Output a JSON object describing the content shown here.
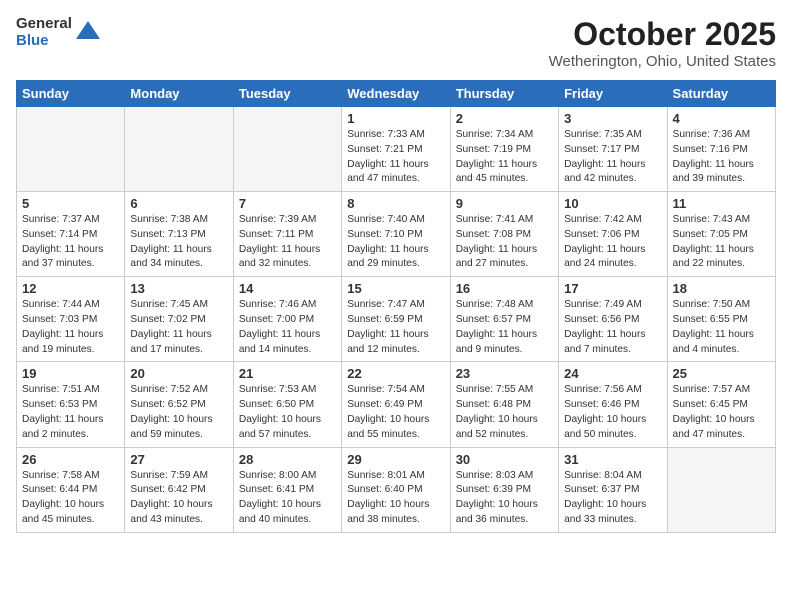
{
  "header": {
    "logo": {
      "line1": "General",
      "line2": "Blue"
    },
    "title": "October 2025",
    "location": "Wetherington, Ohio, United States"
  },
  "days_of_week": [
    "Sunday",
    "Monday",
    "Tuesday",
    "Wednesday",
    "Thursday",
    "Friday",
    "Saturday"
  ],
  "weeks": [
    [
      {
        "num": "",
        "empty": true
      },
      {
        "num": "",
        "empty": true
      },
      {
        "num": "",
        "empty": true
      },
      {
        "num": "1",
        "sunrise": "7:33 AM",
        "sunset": "7:21 PM",
        "daylight": "11 hours and 47 minutes."
      },
      {
        "num": "2",
        "sunrise": "7:34 AM",
        "sunset": "7:19 PM",
        "daylight": "11 hours and 45 minutes."
      },
      {
        "num": "3",
        "sunrise": "7:35 AM",
        "sunset": "7:17 PM",
        "daylight": "11 hours and 42 minutes."
      },
      {
        "num": "4",
        "sunrise": "7:36 AM",
        "sunset": "7:16 PM",
        "daylight": "11 hours and 39 minutes."
      }
    ],
    [
      {
        "num": "5",
        "sunrise": "7:37 AM",
        "sunset": "7:14 PM",
        "daylight": "11 hours and 37 minutes."
      },
      {
        "num": "6",
        "sunrise": "7:38 AM",
        "sunset": "7:13 PM",
        "daylight": "11 hours and 34 minutes."
      },
      {
        "num": "7",
        "sunrise": "7:39 AM",
        "sunset": "7:11 PM",
        "daylight": "11 hours and 32 minutes."
      },
      {
        "num": "8",
        "sunrise": "7:40 AM",
        "sunset": "7:10 PM",
        "daylight": "11 hours and 29 minutes."
      },
      {
        "num": "9",
        "sunrise": "7:41 AM",
        "sunset": "7:08 PM",
        "daylight": "11 hours and 27 minutes."
      },
      {
        "num": "10",
        "sunrise": "7:42 AM",
        "sunset": "7:06 PM",
        "daylight": "11 hours and 24 minutes."
      },
      {
        "num": "11",
        "sunrise": "7:43 AM",
        "sunset": "7:05 PM",
        "daylight": "11 hours and 22 minutes."
      }
    ],
    [
      {
        "num": "12",
        "sunrise": "7:44 AM",
        "sunset": "7:03 PM",
        "daylight": "11 hours and 19 minutes."
      },
      {
        "num": "13",
        "sunrise": "7:45 AM",
        "sunset": "7:02 PM",
        "daylight": "11 hours and 17 minutes."
      },
      {
        "num": "14",
        "sunrise": "7:46 AM",
        "sunset": "7:00 PM",
        "daylight": "11 hours and 14 minutes."
      },
      {
        "num": "15",
        "sunrise": "7:47 AM",
        "sunset": "6:59 PM",
        "daylight": "11 hours and 12 minutes."
      },
      {
        "num": "16",
        "sunrise": "7:48 AM",
        "sunset": "6:57 PM",
        "daylight": "11 hours and 9 minutes."
      },
      {
        "num": "17",
        "sunrise": "7:49 AM",
        "sunset": "6:56 PM",
        "daylight": "11 hours and 7 minutes."
      },
      {
        "num": "18",
        "sunrise": "7:50 AM",
        "sunset": "6:55 PM",
        "daylight": "11 hours and 4 minutes."
      }
    ],
    [
      {
        "num": "19",
        "sunrise": "7:51 AM",
        "sunset": "6:53 PM",
        "daylight": "11 hours and 2 minutes."
      },
      {
        "num": "20",
        "sunrise": "7:52 AM",
        "sunset": "6:52 PM",
        "daylight": "10 hours and 59 minutes."
      },
      {
        "num": "21",
        "sunrise": "7:53 AM",
        "sunset": "6:50 PM",
        "daylight": "10 hours and 57 minutes."
      },
      {
        "num": "22",
        "sunrise": "7:54 AM",
        "sunset": "6:49 PM",
        "daylight": "10 hours and 55 minutes."
      },
      {
        "num": "23",
        "sunrise": "7:55 AM",
        "sunset": "6:48 PM",
        "daylight": "10 hours and 52 minutes."
      },
      {
        "num": "24",
        "sunrise": "7:56 AM",
        "sunset": "6:46 PM",
        "daylight": "10 hours and 50 minutes."
      },
      {
        "num": "25",
        "sunrise": "7:57 AM",
        "sunset": "6:45 PM",
        "daylight": "10 hours and 47 minutes."
      }
    ],
    [
      {
        "num": "26",
        "sunrise": "7:58 AM",
        "sunset": "6:44 PM",
        "daylight": "10 hours and 45 minutes."
      },
      {
        "num": "27",
        "sunrise": "7:59 AM",
        "sunset": "6:42 PM",
        "daylight": "10 hours and 43 minutes."
      },
      {
        "num": "28",
        "sunrise": "8:00 AM",
        "sunset": "6:41 PM",
        "daylight": "10 hours and 40 minutes."
      },
      {
        "num": "29",
        "sunrise": "8:01 AM",
        "sunset": "6:40 PM",
        "daylight": "10 hours and 38 minutes."
      },
      {
        "num": "30",
        "sunrise": "8:03 AM",
        "sunset": "6:39 PM",
        "daylight": "10 hours and 36 minutes."
      },
      {
        "num": "31",
        "sunrise": "8:04 AM",
        "sunset": "6:37 PM",
        "daylight": "10 hours and 33 minutes."
      },
      {
        "num": "",
        "empty": true
      }
    ]
  ],
  "labels": {
    "sunrise_label": "Sunrise:",
    "sunset_label": "Sunset:",
    "daylight_label": "Daylight:"
  }
}
